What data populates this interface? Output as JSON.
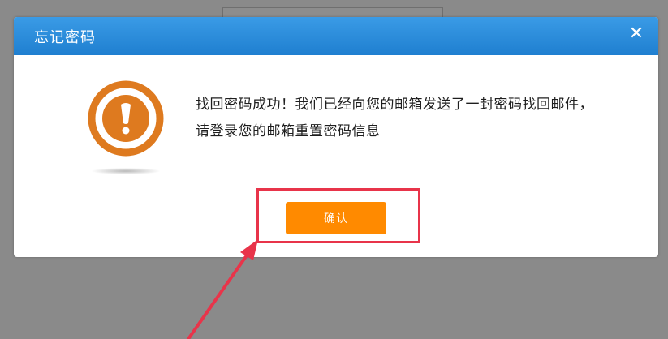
{
  "dialog": {
    "title": "忘记密码",
    "close_glyph": "✕",
    "message": "找回密码成功！我们已经向您的邮箱发送了一封密码找回邮件，请登录您的邮箱重置密码信息",
    "icon": "exclamation-icon",
    "confirm_label": "确认"
  },
  "colors": {
    "titlebar": "#2b8ddc",
    "warning": "#de7a1f",
    "confirm_button": "#ff8a00",
    "annotation": "#e8344a",
    "overlay": "#8a8a8a"
  }
}
